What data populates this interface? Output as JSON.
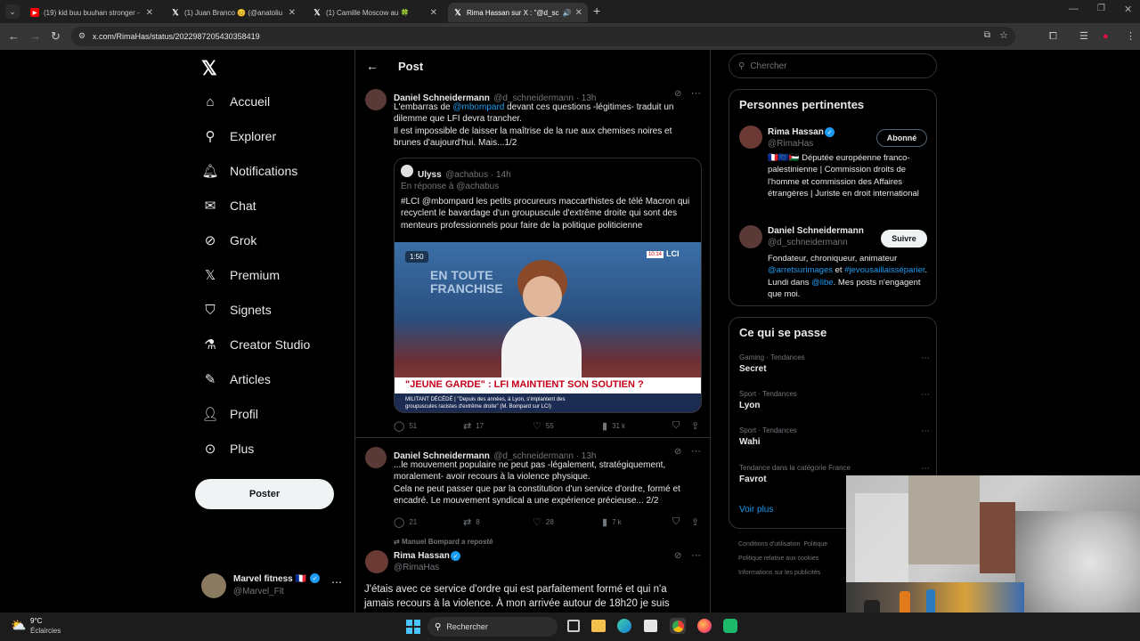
{
  "browser": {
    "tabs": [
      {
        "title": "(19) kid buu buuhan stronger -",
        "icon": "youtube-icon",
        "active": false
      },
      {
        "title": "(1) Juan Branco 😊 (@anatoliu",
        "icon": "x-icon",
        "active": false
      },
      {
        "title": "(1) Camille Moscow au 🍀 ",
        "icon": "x-icon",
        "active": false
      },
      {
        "title": "Rima Hassan sur X : \"@d_sc",
        "icon": "x-icon",
        "active": true
      }
    ],
    "url": "x.com/RimaHas/status/2022987205430358419"
  },
  "nav": {
    "items": [
      {
        "label": "Accueil",
        "icon": "home-icon"
      },
      {
        "label": "Explorer",
        "icon": "search-icon"
      },
      {
        "label": "Notifications",
        "icon": "bell-icon"
      },
      {
        "label": "Chat",
        "icon": "mail-icon"
      },
      {
        "label": "Grok",
        "icon": "grok-icon"
      },
      {
        "label": "Premium",
        "icon": "x-logo-icon"
      },
      {
        "label": "Signets",
        "icon": "bookmark-icon"
      },
      {
        "label": "Creator Studio",
        "icon": "flask-icon"
      },
      {
        "label": "Articles",
        "icon": "article-icon"
      },
      {
        "label": "Profil",
        "icon": "person-icon"
      },
      {
        "label": "Plus",
        "icon": "more-circle-icon"
      }
    ],
    "post_button": "Poster",
    "account": {
      "name": "Marvel fitness 🇫🇷",
      "handle": "@Marvel_Flt"
    }
  },
  "header": {
    "title": "Post"
  },
  "posts": {
    "p1": {
      "name": "Daniel Schneidermann",
      "meta": "@d_schneidermann · 13h",
      "text_a": "L'embarras de ",
      "mention": "@mbompard",
      "text_b": " devant ces questions -légitimes- traduit un dilemme que LFI devra trancher.",
      "text_c": "Il est impossible de laisser la maîtrise de la rue aux chemises noires et brunes d'aujourd'hui. Mais...1/2",
      "quote": {
        "name": "Ulyss",
        "meta": "@achabus · 14h",
        "reply_to": "En réponse à @achabus",
        "text": "#LCI @mbompard les petits procureurs maccarthistes de télé Macron qui recyclent le bavardage d'un groupuscule d'extrême droite qui sont des menteurs professionnels pour faire de la politique politicienne",
        "video": {
          "badge": "1:50",
          "bg_text": "EN TOUTE FRANCHISE",
          "channel": "LCI",
          "time": "10:14",
          "headline": "\"JEUNE GARDE\" : LFI MAINTIENT SON SOUTIEN ?",
          "subline_a": "MILITANT DÉCÉDÉ | \"Depuis des années, à Lyon, s'implantent des",
          "subline_b": "groupuscules racistes d'extrême droite\" (M. Bompard sur LCI)"
        }
      },
      "stats": {
        "replies": "51",
        "reposts": "17",
        "likes": "55",
        "views": "31 k"
      }
    },
    "p2": {
      "name": "Daniel Schneidermann",
      "meta": "@d_schneidermann · 13h",
      "text": "...le mouvement populaire ne peut pas -légalement, stratégiquement, moralement- avoir recours à la violence physique.",
      "text2": "Cela ne peut passer que par la constitution d'un service d'ordre, formé et encadré. Le mouvement syndical a une expérience précieuse... 2/2",
      "stats": {
        "replies": "21",
        "reposts": "8",
        "likes": "28",
        "views": "7 k"
      }
    },
    "p3": {
      "repost_label": "Manuel Bompard a reposté",
      "name": "Rima Hassan",
      "handle": "@RimaHas",
      "text": "J'étais avec ce service d'ordre qui est parfaitement formé et qui n'a jamais recours à la violence. À mon arrivée autour de 18h20 je suis"
    }
  },
  "search": {
    "placeholder": "Chercher"
  },
  "relevant": {
    "title": "Personnes pertinentes",
    "people": [
      {
        "name": "Rima Hassan",
        "handle": "@RimaHas",
        "button": "Abonné",
        "bio": "🇫🇷🇪🇺🇵🇸 Députée européenne franco-palestinienne | Commission droits de l'homme et commission des Affaires étrangères | Juriste en droit international"
      },
      {
        "name": "Daniel Schneidermann",
        "handle": "@d_schneidermann",
        "button": "Suivre",
        "bio_a": "Fondateur, chroniqueur, animateur ",
        "bio_link1": "@arretsurimages",
        "bio_b": " et ",
        "bio_link2": "#jevousaillaisséparier",
        "bio_c": ". Lundi dans ",
        "bio_link3": "@libe",
        "bio_d": ". Mes posts n'engagent que moi."
      }
    ]
  },
  "trends": {
    "title": "Ce qui se passe",
    "items": [
      {
        "category": "Gaming · Tendances",
        "name": "Secret"
      },
      {
        "category": "Sport · Tendances",
        "name": "Lyon"
      },
      {
        "category": "Sport · Tendances",
        "name": "Wahi"
      },
      {
        "category": "Tendance dans la catégorie France",
        "name": "Favrot"
      }
    ],
    "see_more": "Voir plus"
  },
  "footer_links": [
    "Conditions d'utilisation",
    "Politique",
    "Politique relative aux cookies",
    "Informations sur les publicités"
  ],
  "taskbar": {
    "weather_temp": "9°C",
    "weather_desc": "Éclaircies",
    "search_label": "Rechercher"
  },
  "colors": {
    "accent": "#1d9bf0",
    "border": "#2f3336",
    "muted": "#71767b"
  }
}
